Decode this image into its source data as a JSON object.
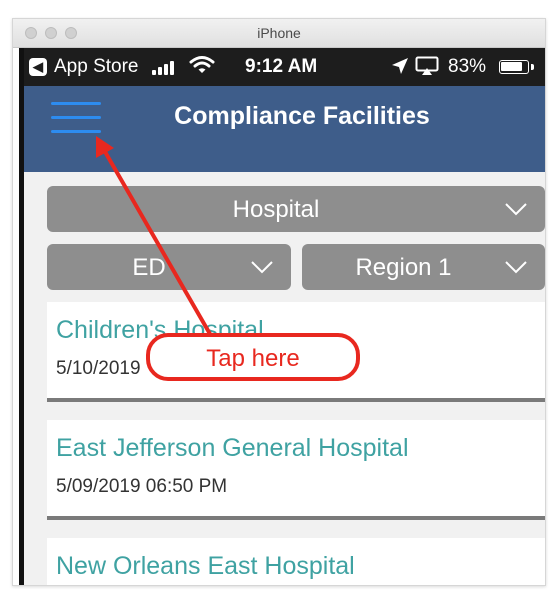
{
  "window": {
    "title": "iPhone"
  },
  "status_bar": {
    "back_app": "App Store",
    "time": "9:12 AM",
    "battery_percent": "83%",
    "battery_level": 0.83
  },
  "nav": {
    "title": "Compliance Facilities",
    "menu_icon": "hamburger-icon"
  },
  "filters": {
    "facility_type": "Hospital",
    "department": "ED",
    "region": "Region 1"
  },
  "facilities": [
    {
      "name": "Children's Hospital",
      "date": "5/10/2019"
    },
    {
      "name": "East Jefferson General Hospital",
      "date": "5/09/2019 06:50 PM"
    },
    {
      "name": "New Orleans East Hospital",
      "date": ""
    }
  ],
  "annotation": {
    "text": "Tap here",
    "color": "#e8281f"
  },
  "colors": {
    "nav_bar": "#3e5d8a",
    "dropdown": "#8e8e8e",
    "facility_name": "#3fa2a2",
    "menu_icon": "#2d8cf0"
  }
}
